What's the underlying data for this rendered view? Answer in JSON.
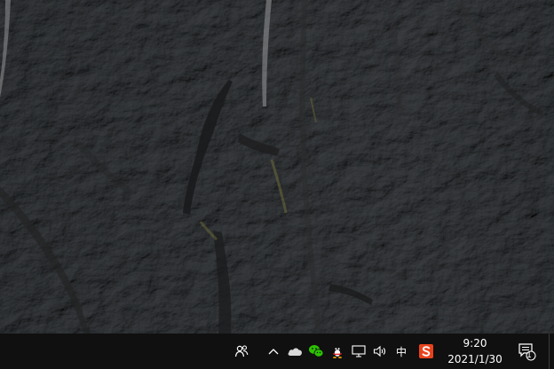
{
  "taskbar": {
    "background": "#101010",
    "tray": {
      "icons": [
        "people-icon",
        "show-hidden-icons-chevron",
        "onedrive-cloud-icon",
        "wechat-icon",
        "qq-penguin-icon",
        "network-icon",
        "volume-icon",
        "sogou-ime-icon",
        "action-center-icon"
      ],
      "ime_mode": "中",
      "clock": {
        "time": "9:20",
        "date": "2021/1/30"
      },
      "notification_count": "1"
    }
  },
  "colors": {
    "sogou_orange": "#e8431c",
    "wechat_green": "#2dc100",
    "qq_red": "#e02020"
  }
}
